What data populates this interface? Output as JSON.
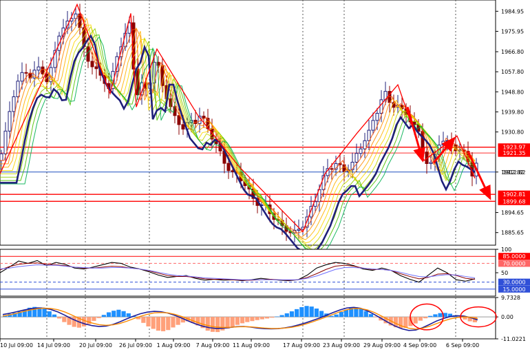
{
  "chart_data": [
    {
      "type": "candlestick",
      "panel": "main",
      "ylim": [
        1880,
        1990
      ],
      "y_tick_labels": [
        {
          "label": "1984.95",
          "value": 1984.95
        },
        {
          "label": "1975.95",
          "value": 1975.95
        },
        {
          "label": "1966.80",
          "value": 1966.8
        },
        {
          "label": "1057.80",
          "value": 1957.8
        },
        {
          "label": "1948.80",
          "value": 1948.8
        },
        {
          "label": "1939.80",
          "value": 1939.8
        },
        {
          "label": "1930.80",
          "value": 1930.8
        },
        {
          "label": "1912.82",
          "value": 1912.82
        },
        {
          "label": "1894.65",
          "value": 1894.65
        },
        {
          "label": "1885.65",
          "value": 1885.65
        }
      ],
      "horizontal_lines": [
        {
          "label": "1923.97",
          "value": 1923.97,
          "color": "#ff0000",
          "badge": true
        },
        {
          "label": "1921.35",
          "value": 1921.35,
          "color": "#ff6666",
          "badge": true
        },
        {
          "label": "1912.82",
          "value": 1912.82,
          "color": "#1f4fbf",
          "badge": true
        },
        {
          "label": "1902.81",
          "value": 1902.81,
          "color": "#ff0000",
          "badge": true
        },
        {
          "label": "1899.68",
          "value": 1899.68,
          "color": "#ff0000",
          "badge": true
        }
      ],
      "price_path": [
        [
          0,
          1918
        ],
        [
          8,
          1930
        ],
        [
          15,
          1942
        ],
        [
          22,
          1950
        ],
        [
          30,
          1956
        ],
        [
          38,
          1958
        ],
        [
          46,
          1955
        ],
        [
          54,
          1960
        ],
        [
          62,
          1958
        ],
        [
          70,
          1952
        ],
        [
          78,
          1965
        ],
        [
          86,
          1975
        ],
        [
          95,
          1978
        ],
        [
          103,
          1982
        ],
        [
          111,
          1985
        ],
        [
          120,
          1970
        ],
        [
          130,
          1962
        ],
        [
          140,
          1958
        ],
        [
          150,
          1955
        ],
        [
          158,
          1950
        ],
        [
          165,
          1958
        ],
        [
          172,
          1968
        ],
        [
          180,
          1972
        ],
        [
          187,
          1980
        ],
        [
          192,
          1975
        ],
        [
          196,
          1945
        ],
        [
          200,
          1948
        ],
        [
          208,
          1953
        ],
        [
          215,
          1948
        ],
        [
          222,
          1962
        ],
        [
          228,
          1962
        ],
        [
          236,
          1952
        ],
        [
          244,
          1945
        ],
        [
          252,
          1938
        ],
        [
          260,
          1935
        ],
        [
          268,
          1932
        ],
        [
          276,
          1936
        ],
        [
          282,
          1935
        ],
        [
          290,
          1938
        ],
        [
          298,
          1935
        ],
        [
          306,
          1930
        ],
        [
          314,
          1925
        ],
        [
          322,
          1920
        ],
        [
          330,
          1915
        ],
        [
          338,
          1912
        ],
        [
          346,
          1912
        ],
        [
          354,
          1908
        ],
        [
          362,
          1904
        ],
        [
          370,
          1900
        ],
        [
          378,
          1898
        ],
        [
          386,
          1897
        ],
        [
          394,
          1894
        ],
        [
          402,
          1891
        ],
        [
          410,
          1888
        ],
        [
          418,
          1887
        ],
        [
          426,
          1885
        ],
        [
          434,
          1887
        ],
        [
          442,
          1890
        ],
        [
          450,
          1895
        ],
        [
          458,
          1900
        ],
        [
          466,
          1908
        ],
        [
          474,
          1913
        ],
        [
          482,
          1915
        ],
        [
          490,
          1918
        ],
        [
          498,
          1912
        ],
        [
          506,
          1915
        ],
        [
          514,
          1918
        ],
        [
          522,
          1922
        ],
        [
          530,
          1928
        ],
        [
          538,
          1932
        ],
        [
          546,
          1938
        ],
        [
          554,
          1946
        ],
        [
          560,
          1948
        ],
        [
          568,
          1942
        ],
        [
          576,
          1944
        ],
        [
          584,
          1940
        ],
        [
          592,
          1938
        ],
        [
          600,
          1935
        ],
        [
          608,
          1930
        ],
        [
          616,
          1920
        ],
        [
          624,
          1915
        ],
        [
          632,
          1920
        ],
        [
          640,
          1928
        ],
        [
          648,
          1926
        ],
        [
          656,
          1925
        ],
        [
          664,
          1923
        ],
        [
          672,
          1922
        ],
        [
          680,
          1918
        ],
        [
          686,
          1912
        ],
        [
          692,
          1916
        ]
      ],
      "moving_averages_ribbon": {
        "color_sequence": [
          "#ff4f00",
          "#ff8c00",
          "#ffb300",
          "#ffd700",
          "#c8d800",
          "#8fce00",
          "#4fc100",
          "#00b050"
        ],
        "main_line_color": "#1f1f7a"
      },
      "trend_zigzag": [
        [
          0,
          1912
        ],
        [
          112,
          1988
        ],
        [
          160,
          1948
        ],
        [
          190,
          1984
        ],
        [
          198,
          1942
        ],
        [
          228,
          1968
        ],
        [
          288,
          1938
        ],
        [
          348,
          1915
        ],
        [
          440,
          1886
        ],
        [
          472,
          1912
        ],
        [
          518,
          1930
        ],
        [
          578,
          1952
        ],
        [
          616,
          1918
        ],
        [
          664,
          1929
        ],
        [
          690,
          1910
        ]
      ],
      "annotation_arrows": [
        {
          "from": [
            592,
            1942
          ],
          "to": [
            614,
            1918
          ],
          "color": "#ff0000"
        },
        {
          "from": [
            630,
            1917
          ],
          "to": [
            660,
            1928
          ],
          "color": "#ff0000"
        },
        {
          "from": [
            680,
            1922
          ],
          "to": [
            712,
            1901
          ],
          "color": "#ff0000"
        }
      ],
      "colors": {
        "bull": "#1f1f7a",
        "bear": "#8b0000",
        "grid": "#444444"
      }
    },
    {
      "type": "line",
      "panel": "rsi",
      "ylim": [
        0,
        100
      ],
      "y_tick_labels": [
        {
          "label": "100",
          "value": 100
        },
        {
          "label": "50",
          "value": 50
        }
      ],
      "levels": [
        {
          "label": "85.0000",
          "value": 85,
          "color": "#ff0000"
        },
        {
          "label": "70.0000",
          "value": 70,
          "color": "#ff6666"
        },
        {
          "label": "30.0000",
          "value": 30,
          "color": "#2f4fd8"
        },
        {
          "label": "15.0000",
          "value": 15,
          "color": "#2f4fd8"
        }
      ],
      "series": [
        {
          "values": [
            50,
            62,
            75,
            70,
            76,
            65,
            72,
            68,
            60,
            58,
            62,
            67,
            72,
            70,
            62,
            58,
            52,
            45,
            40,
            42,
            44,
            38,
            34,
            36,
            34,
            35,
            33,
            35,
            38,
            36,
            34,
            33,
            35,
            45,
            60,
            67,
            72,
            70,
            65,
            58,
            55,
            60,
            55,
            44,
            36,
            30,
            45,
            60,
            50,
            35,
            32,
            37
          ],
          "color": "#000000"
        },
        {
          "values": [
            56,
            63,
            68,
            70,
            71,
            68,
            67,
            65,
            62,
            60,
            60,
            62,
            64,
            63,
            60,
            58,
            54,
            49,
            44,
            42,
            42,
            40,
            37,
            36,
            36,
            35,
            34,
            34,
            35,
            36,
            35,
            34,
            35,
            40,
            48,
            57,
            64,
            66,
            64,
            60,
            57,
            57,
            55,
            48,
            42,
            37,
            40,
            47,
            48,
            44,
            38,
            36
          ],
          "color": "#8b0000"
        },
        {
          "values": [
            58,
            60,
            63,
            65,
            67,
            66,
            66,
            64,
            62,
            61,
            60,
            60,
            61,
            61,
            60,
            58,
            55,
            51,
            47,
            44,
            43,
            41,
            39,
            38,
            37,
            36,
            35,
            35,
            35,
            35,
            35,
            35,
            35,
            38,
            43,
            50,
            57,
            61,
            61,
            60,
            58,
            57,
            55,
            51,
            46,
            42,
            41,
            44,
            46,
            45,
            42,
            39
          ],
          "color": "#6f6fff"
        }
      ]
    },
    {
      "type": "bar",
      "panel": "macd",
      "ylim": [
        -11.0221,
        9.7328
      ],
      "y_tick_labels": [
        {
          "label": "9.7328",
          "value": 9.7328
        },
        {
          "label": "0.00",
          "value": 0
        },
        {
          "label": "-11.0221",
          "value": -11.0221
        }
      ],
      "histogram": [
        0.8,
        1.4,
        2.0,
        2.7,
        3.5,
        4.6,
        5.0,
        4.8,
        4.1,
        2.8,
        1.2,
        -0.8,
        -2.6,
        -4.0,
        -5.0,
        -5.4,
        -4.8,
        -3.6,
        -2.0,
        -0.6,
        1.0,
        2.3,
        3.1,
        3.6,
        2.9,
        1.8,
        0.4,
        -1.2,
        -3.0,
        -4.8,
        -6.0,
        -6.9,
        -7.2,
        -6.6,
        -5.3,
        -4.0,
        -2.8,
        -2.2,
        -3.1,
        -4.3,
        -5.6,
        -6.9,
        -7.5,
        -7.6,
        -6.8,
        -5.9,
        -4.9,
        -4.0,
        -3.2,
        -2.6,
        -2.1,
        -1.6,
        -1.2,
        -0.8,
        -0.4,
        0.2,
        0.9,
        1.8,
        2.8,
        3.9,
        4.9,
        5.5,
        5.2,
        4.2,
        3.0,
        1.7,
        0.5,
        1.2,
        2.5,
        3.6,
        4.5,
        4.8,
        4.1,
        2.9,
        1.4,
        -0.2,
        -1.8,
        -3.2,
        -4.3,
        -5.2,
        -5.7,
        -5.5,
        -4.6,
        -3.3,
        -1.9,
        -0.7,
        0.5,
        1.3,
        1.9,
        2.0,
        1.6,
        0.8,
        -0.2,
        -1.3,
        -2.2,
        -2.7
      ],
      "signal_lines": [
        {
          "values": [
            1.2,
            1.8,
            2.6,
            3.4,
            4.1,
            4.5,
            4.4,
            3.7,
            2.5,
            0.9,
            -0.9,
            -2.4,
            -3.6,
            -4.4,
            -4.8,
            -4.6,
            -3.8,
            -2.5,
            -1.0,
            0.4,
            1.6,
            2.4,
            2.8,
            2.6,
            1.9,
            0.8,
            -0.6,
            -2.1,
            -3.5,
            -4.6,
            -5.4,
            -5.8,
            -5.7,
            -5.3,
            -4.9,
            -4.8,
            -5.1,
            -5.6,
            -5.9,
            -6.0,
            -5.9,
            -5.5,
            -4.9,
            -4.0,
            -3.0,
            -1.8,
            -0.6,
            0.8,
            2.2,
            3.5,
            4.5,
            4.8,
            4.3,
            3.0,
            1.2,
            -0.8,
            -2.8,
            -4.6,
            -6.0,
            -6.8,
            -6.6,
            -5.4,
            -3.8,
            -2.1,
            -0.8,
            0.2,
            0.6,
            0.4,
            -0.4,
            -1.5
          ],
          "color": "#1f1f9a"
        },
        {
          "values": [
            0.4,
            1.0,
            1.8,
            2.7,
            3.5,
            4.1,
            4.4,
            4.2,
            3.6,
            2.5,
            1.0,
            -0.6,
            -2.0,
            -3.1,
            -3.9,
            -4.2,
            -4.0,
            -3.3,
            -2.2,
            -0.9,
            0.3,
            1.3,
            2.0,
            2.2,
            2.0,
            1.3,
            0.2,
            -1.1,
            -2.4,
            -3.6,
            -4.5,
            -5.1,
            -5.3,
            -5.2,
            -5.0,
            -4.9,
            -5.0,
            -5.3,
            -5.6,
            -5.8,
            -5.8,
            -5.6,
            -5.2,
            -4.5,
            -3.6,
            -2.5,
            -1.3,
            0.0,
            1.3,
            2.6,
            3.6,
            4.2,
            4.2,
            3.5,
            2.2,
            0.5,
            -1.3,
            -3.1,
            -4.6,
            -5.7,
            -6.1,
            -5.7,
            -4.7,
            -3.4,
            -2.1,
            -1.0,
            -0.3,
            0.0,
            -0.2,
            -0.8
          ],
          "color": "#ff8c00"
        }
      ],
      "highlight_ellipses": [
        {
          "cx": 620,
          "cy": 0.0,
          "rx": 24,
          "ry": 6.5,
          "color": "#ff0000"
        },
        {
          "cx": 695,
          "cy": 0.0,
          "rx": 26,
          "ry": 5.0,
          "color": "#ff0000"
        }
      ],
      "colors": {
        "positive": "#1e90ff",
        "negative": "#ffa07a",
        "zero": "#9a9a9a"
      }
    }
  ],
  "x_axis": {
    "labels": [
      {
        "label": "10 Jul 09:00",
        "x": 0
      },
      {
        "label": "14 Jul 09:00",
        "x": 78
      },
      {
        "label": "20 Jul 09:00",
        "x": 139
      },
      {
        "label": "26 Jul 09:00",
        "x": 197
      },
      {
        "label": "1 Aug 09:00",
        "x": 252
      },
      {
        "label": "7 Aug 09:00",
        "x": 309
      },
      {
        "label": "11 Aug 09:00",
        "x": 365
      },
      {
        "label": "17 Aug 09:00",
        "x": 438
      },
      {
        "label": "23 Aug 09:00",
        "x": 496
      },
      {
        "label": "29 Aug 09:00",
        "x": 555
      },
      {
        "label": "4 Sep 09:00",
        "x": 610
      },
      {
        "label": "6 Sep 09:00",
        "x": 672
      }
    ],
    "dashed_gridlines": [
      68,
      124,
      217,
      440,
      500,
      662
    ]
  }
}
